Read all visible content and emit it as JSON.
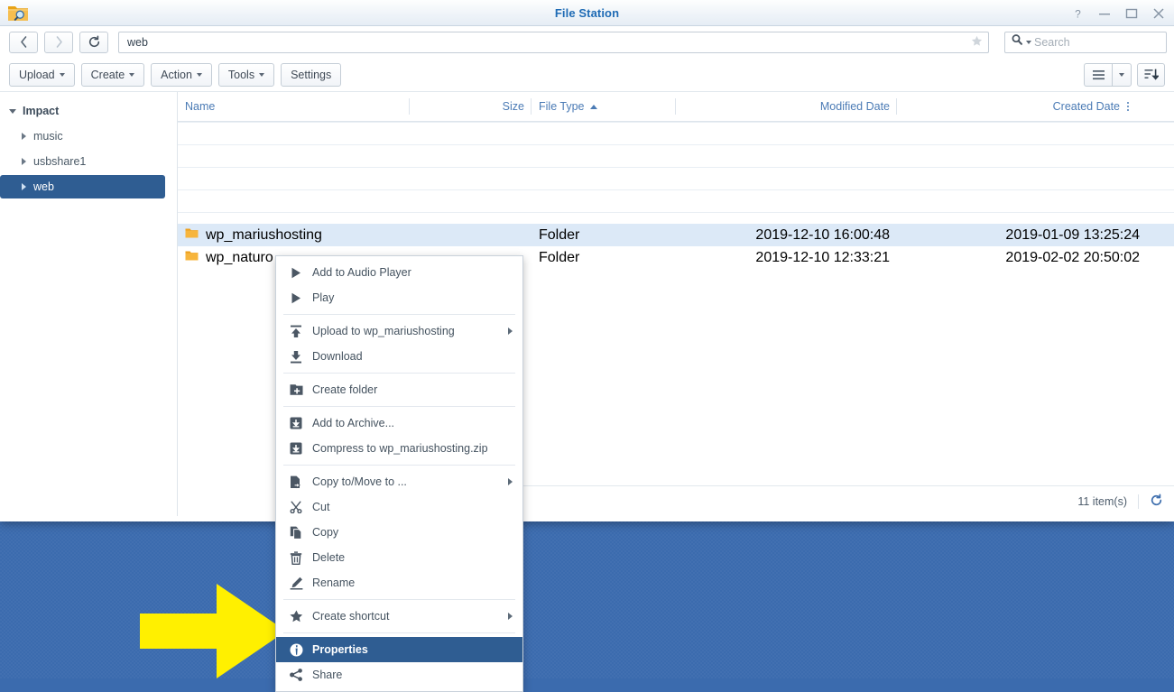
{
  "window": {
    "title": "File Station",
    "app_icon": "folder-search-icon",
    "controls": [
      {
        "name": "help-button",
        "glyph": "?"
      },
      {
        "name": "minimize-button",
        "glyph": "−"
      },
      {
        "name": "maximize-button",
        "glyph": "□"
      },
      {
        "name": "close-button",
        "glyph": "✕"
      }
    ]
  },
  "nav": {
    "back_icon": "chevron-left-icon",
    "forward_icon": "chevron-right-icon",
    "refresh_icon": "refresh-icon",
    "path_value": "web",
    "favorite_icon": "star-icon",
    "search_placeholder": "Search",
    "search_value": "",
    "search_icon": "search-icon"
  },
  "toolbar": {
    "buttons": [
      {
        "label": "Upload",
        "caret": true,
        "name": "upload-button"
      },
      {
        "label": "Create",
        "caret": true,
        "name": "create-button"
      },
      {
        "label": "Action",
        "caret": true,
        "name": "action-button"
      },
      {
        "label": "Tools",
        "caret": true,
        "name": "tools-button"
      },
      {
        "label": "Settings",
        "caret": false,
        "name": "settings-button"
      }
    ],
    "view_mode_icon": "list-view-icon",
    "view_mode_caret_icon": "chevron-down-icon",
    "sort_icon": "sort-descending-icon"
  },
  "sidebar": {
    "root": {
      "label": "Impact",
      "expanded": true
    },
    "items": [
      {
        "label": "music",
        "selected": false
      },
      {
        "label": "usbshare1",
        "selected": false
      },
      {
        "label": "web",
        "selected": true
      }
    ]
  },
  "columns": [
    {
      "key": "name",
      "label": "Name",
      "align": "left",
      "sorted": false
    },
    {
      "key": "size",
      "label": "Size",
      "align": "right",
      "sorted": false
    },
    {
      "key": "filetype",
      "label": "File Type",
      "align": "left",
      "sorted": true,
      "sort_dir": "asc"
    },
    {
      "key": "modified",
      "label": "Modified Date",
      "align": "right",
      "sorted": false
    },
    {
      "key": "created",
      "label": "Created Date",
      "align": "right",
      "sorted": false
    }
  ],
  "column_options_icon": "kebab-menu-icon",
  "rows": [
    {
      "name": "wp_mariushosting",
      "icon": "folder-icon",
      "size": "",
      "filetype": "Folder",
      "modified": "2019-12-10 16:00:48",
      "created": "2019-01-09 13:25:24",
      "selected": true
    },
    {
      "name": "wp_naturo",
      "icon": "folder-icon",
      "size": "",
      "filetype": "Folder",
      "modified": "2019-12-10 12:33:21",
      "created": "2019-02-02 20:50:02",
      "selected": false
    }
  ],
  "status": {
    "item_count": "11 item(s)",
    "refresh_icon": "refresh-icon"
  },
  "context_menu": {
    "target": "wp_mariushosting",
    "items": [
      {
        "label": "Add to Audio Player",
        "icon": "play-icon",
        "submenu": false,
        "active": false,
        "separator_after": false
      },
      {
        "label": "Play",
        "icon": "play-icon",
        "submenu": false,
        "active": false,
        "separator_after": true
      },
      {
        "label": "Upload to wp_mariushosting",
        "icon": "upload-icon",
        "submenu": true,
        "active": false,
        "separator_after": false
      },
      {
        "label": "Download",
        "icon": "download-icon",
        "submenu": false,
        "active": false,
        "separator_after": true
      },
      {
        "label": "Create folder",
        "icon": "new-folder-icon",
        "submenu": false,
        "active": false,
        "separator_after": true
      },
      {
        "label": "Add to Archive...",
        "icon": "archive-icon",
        "submenu": false,
        "active": false,
        "separator_after": false
      },
      {
        "label": "Compress to wp_mariushosting.zip",
        "icon": "archive-icon",
        "submenu": false,
        "active": false,
        "separator_after": true
      },
      {
        "label": "Copy to/Move to ...",
        "icon": "copy-move-icon",
        "submenu": true,
        "active": false,
        "separator_after": false
      },
      {
        "label": "Cut",
        "icon": "scissors-icon",
        "submenu": false,
        "active": false,
        "separator_after": false
      },
      {
        "label": "Copy",
        "icon": "copy-icon",
        "submenu": false,
        "active": false,
        "separator_after": false
      },
      {
        "label": "Delete",
        "icon": "trash-icon",
        "submenu": false,
        "active": false,
        "separator_after": false
      },
      {
        "label": "Rename",
        "icon": "pencil-icon",
        "submenu": false,
        "active": false,
        "separator_after": true
      },
      {
        "label": "Create shortcut",
        "icon": "star-icon",
        "submenu": true,
        "active": false,
        "separator_after": true
      },
      {
        "label": "Properties",
        "icon": "info-icon",
        "submenu": false,
        "active": true,
        "separator_after": false
      },
      {
        "label": "Share",
        "icon": "share-icon",
        "submenu": false,
        "active": false,
        "separator_after": false
      }
    ]
  },
  "annotation": {
    "arrow": {
      "name": "yellow-pointer-arrow",
      "color": "#FFF000",
      "direction": "right"
    }
  },
  "colors": {
    "accent": "#2f5d92",
    "selection": "#dce9f7",
    "desktop": "#3b6bae",
    "title_text": "#1f6bb5",
    "header_text": "#4b7bb5",
    "folder": "#f5a623"
  }
}
